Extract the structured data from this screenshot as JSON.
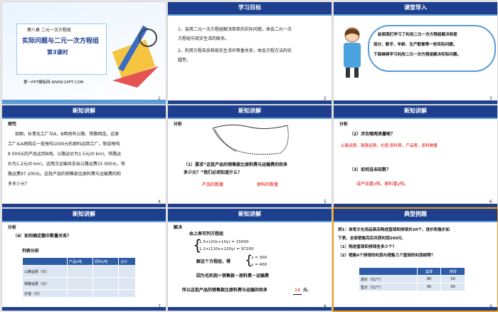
{
  "s1": {
    "chapter": "第八章 二元一次方程组",
    "title1": "实际问题与二元一次方程组",
    "title2": "第3课时",
    "site": "第一PPT模板网-WWW.1PPT.COM",
    "num": "1"
  },
  "s2": {
    "header": "学习目标",
    "goal1a": "1、会用二元一次方程组解决简单的实际问题，体会二元一次",
    "goal1b": "方程组与现实生活的联系。",
    "goal2a": "2、利用方程去反映现实生活中等量关系，体会方程方法的优",
    "goal2b": "越性。",
    "num": "2"
  },
  "s3": {
    "header": "课堂导入",
    "b1": "前面我们学习了利用二元一次方程组解决和差",
    "b2": "倍分、数字、年龄、生产配套等一些实际问题，",
    "b3": "下面继续学习利用二元一次方程组解决实际问题。",
    "num": "3"
  },
  "s4": {
    "header": "新知讲解",
    "label": "探究",
    "lines": [
      "如图，长青化工厂与A，B两地有公路、铁路相连。这家",
      "工厂从A地购买一批每吨1000元的原料运回工厂，制成每吨",
      "8 000元的产品运到B地。公路运价为1.5元/(t·km)，铁路运",
      "价为1.2元/(t·km)，这两次运输共支出公路运费15 000元，铁",
      "路运费97 200元，这批产品的销售款比原料费与运输费的和",
      "多多少元？"
    ],
    "num": "4"
  },
  "s5": {
    "header": "新知讲解",
    "label": "分析",
    "q1": "（1）要求“这批产品的销售款比原料费与运输费的和多",
    "q2": "多少元？”我们必须知道什么？",
    "ans1": "产品的数量",
    "ans2": "原料的数量",
    "num": "5"
  },
  "s6": {
    "header": "新知讲解",
    "label": "分析",
    "q": "（2）涉及哪两类量呢？",
    "a": "公路运费，铁路运费，价值  原料费，产品费，原料数量",
    "q3": "（3）如何设未知数？",
    "a3": "设产品重x吨，原料重y吨。",
    "num": "6"
  },
  "s7": {
    "header": "新知讲解",
    "label": "分析",
    "q": "（4）如何确定题中数量关系？",
    "tlabel": "列表分析",
    "cols": [
      "",
      "产品x吨",
      "原料y吨",
      "合计"
    ],
    "rows": [
      "公路运费（元）",
      "铁路运费（元）",
      "价值（元）"
    ],
    "num": "7"
  },
  "s8": {
    "header": "新知讲解",
    "label": "解决",
    "l1": "由上表可列方程组",
    "e1": "1.5×(20x+10y) = 15000",
    "e2": "1.2×(110x+120y) = 97200",
    "l2": "解这个方程组，得",
    "x": "x = 300",
    "y": "y = 400",
    "l3": "因为毛利润＝销售款－原料费－运输费",
    "l4": "所以这批产品的销售款比原料费与运输的和多",
    "ans": "14",
    "unit": "元.",
    "num": "8"
  },
  "s9": {
    "header": "典型例题",
    "p1": "例1：体育文化用品商店购进篮球和排球共20个，进价和售价如",
    "p2": "下表，全部销售完后共获利润260元.",
    "p3": "（1）购进篮球和排球各多少个？",
    "p4": "（2）销售6个排球的利润与销售几个篮球的利润相等？",
    "cols": [
      "",
      "篮球",
      "排球"
    ],
    "rows": [
      [
        "进价（元/个）",
        "80",
        "50"
      ],
      [
        "售价（元/个）",
        "95",
        "60"
      ]
    ],
    "num": "9"
  },
  "colors": {
    "header": "#1d3f8e",
    "accent": "#5b9bd5",
    "selected": "#f39c12",
    "red": "#e00000"
  }
}
